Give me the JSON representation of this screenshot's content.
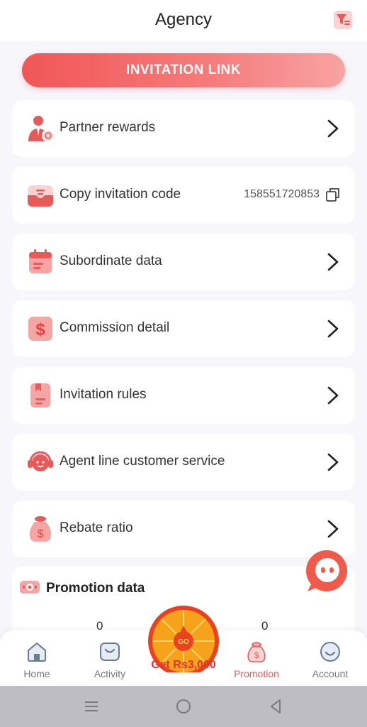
{
  "header": {
    "title": "Agency",
    "filter_icon": "filter-icon"
  },
  "invite_button": {
    "label": "INVITATION LINK"
  },
  "menu": [
    {
      "label": "Partner rewards",
      "icon": "partner-rewards-icon"
    },
    {
      "label": "Copy invitation code",
      "icon": "invitation-code-icon",
      "code": "158551720853"
    },
    {
      "label": "Subordinate data",
      "icon": "calendar-icon"
    },
    {
      "label": "Commission detail",
      "icon": "dollar-icon"
    },
    {
      "label": "Invitation rules",
      "icon": "rules-book-icon"
    },
    {
      "label": "Agent line customer service",
      "icon": "customer-service-icon"
    },
    {
      "label": "Rebate ratio",
      "icon": "money-bag-icon"
    }
  ],
  "promotion": {
    "title": "Promotion data",
    "values": [
      "0",
      "0"
    ]
  },
  "spin_wheel": {
    "label": "Get Rs3,000",
    "center": "GO"
  },
  "tabbar": {
    "tabs": [
      {
        "label": "Home",
        "icon": "home-icon"
      },
      {
        "label": "Activity",
        "icon": "activity-icon"
      },
      {
        "label": "Promotion",
        "icon": "promotion-icon",
        "active": true
      },
      {
        "label": "Account",
        "icon": "account-icon"
      }
    ]
  },
  "colors": {
    "accent": "#e85a5a",
    "background": "#f6f6fb",
    "card": "#ffffff"
  }
}
